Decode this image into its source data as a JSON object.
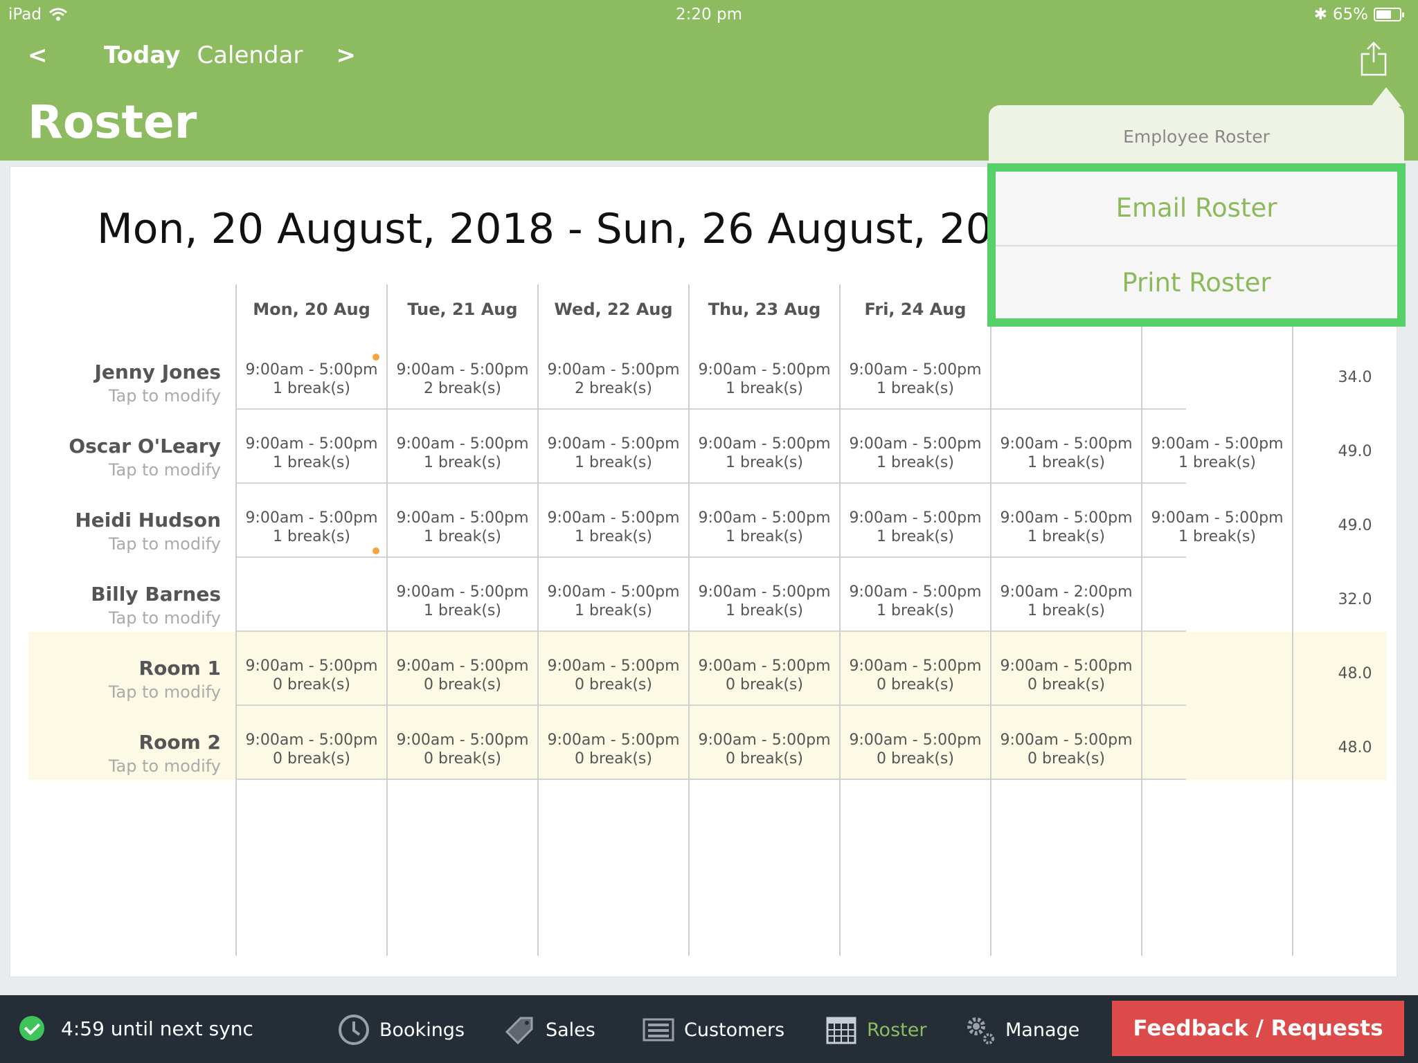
{
  "status_bar": {
    "device": "iPad",
    "time": "2:20 pm",
    "battery_percent": "65%",
    "battery_level": 0.65
  },
  "header": {
    "prev_label": "<",
    "today_label": "Today",
    "calendar_label": "Calendar",
    "next_label": ">",
    "title": "Roster",
    "brand_color": "#8dbb60"
  },
  "content": {
    "date_range": "Mon, 20 August, 2018 - Sun, 26 August, 2018",
    "columns": [
      "Mon, 20 Aug",
      "Tue, 21 Aug",
      "Wed, 22 Aug",
      "Thu, 23 Aug",
      "Fri, 24 Aug"
    ],
    "rows": [
      {
        "name": "Jenny Jones",
        "sub": "Tap to modify",
        "total": "34.0",
        "cells": [
          {
            "time": "9:00am - 5:00pm",
            "breaks": "1 break(s)"
          },
          {
            "time": "9:00am - 5:00pm",
            "breaks": "2 break(s)"
          },
          {
            "time": "9:00am - 5:00pm",
            "breaks": "2 break(s)"
          },
          {
            "time": "9:00am - 5:00pm",
            "breaks": "1 break(s)"
          },
          {
            "time": "9:00am - 5:00pm",
            "breaks": "1 break(s)"
          },
          {
            "time": "",
            "breaks": ""
          },
          {
            "time": "",
            "breaks": ""
          }
        ]
      },
      {
        "name": "Oscar O'Leary",
        "sub": "Tap to modify",
        "total": "49.0",
        "cells": [
          {
            "time": "9:00am - 5:00pm",
            "breaks": "1 break(s)"
          },
          {
            "time": "9:00am - 5:00pm",
            "breaks": "1 break(s)"
          },
          {
            "time": "9:00am - 5:00pm",
            "breaks": "1 break(s)"
          },
          {
            "time": "9:00am - 5:00pm",
            "breaks": "1 break(s)"
          },
          {
            "time": "9:00am - 5:00pm",
            "breaks": "1 break(s)"
          },
          {
            "time": "9:00am - 5:00pm",
            "breaks": "1 break(s)"
          },
          {
            "time": "9:00am - 5:00pm",
            "breaks": "1 break(s)"
          }
        ]
      },
      {
        "name": "Heidi Hudson",
        "sub": "Tap to modify",
        "total": "49.0",
        "cells": [
          {
            "time": "9:00am - 5:00pm",
            "breaks": "1 break(s)"
          },
          {
            "time": "9:00am - 5:00pm",
            "breaks": "1 break(s)"
          },
          {
            "time": "9:00am - 5:00pm",
            "breaks": "1 break(s)"
          },
          {
            "time": "9:00am - 5:00pm",
            "breaks": "1 break(s)"
          },
          {
            "time": "9:00am - 5:00pm",
            "breaks": "1 break(s)"
          },
          {
            "time": "9:00am - 5:00pm",
            "breaks": "1 break(s)"
          },
          {
            "time": "9:00am - 5:00pm",
            "breaks": "1 break(s)"
          }
        ]
      },
      {
        "name": "Billy Barnes",
        "sub": "Tap to modify",
        "total": "32.0",
        "cells": [
          {
            "time": "",
            "breaks": ""
          },
          {
            "time": "9:00am - 5:00pm",
            "breaks": "1 break(s)"
          },
          {
            "time": "9:00am - 5:00pm",
            "breaks": "1 break(s)"
          },
          {
            "time": "9:00am - 5:00pm",
            "breaks": "1 break(s)"
          },
          {
            "time": "9:00am - 5:00pm",
            "breaks": "1 break(s)"
          },
          {
            "time": "9:00am - 2:00pm",
            "breaks": "1 break(s)"
          },
          {
            "time": "",
            "breaks": ""
          }
        ]
      },
      {
        "name": "Room 1",
        "sub": "Tap to modify",
        "total": "48.0",
        "cells": [
          {
            "time": "9:00am - 5:00pm",
            "breaks": "0 break(s)"
          },
          {
            "time": "9:00am - 5:00pm",
            "breaks": "0 break(s)"
          },
          {
            "time": "9:00am - 5:00pm",
            "breaks": "0 break(s)"
          },
          {
            "time": "9:00am - 5:00pm",
            "breaks": "0 break(s)"
          },
          {
            "time": "9:00am - 5:00pm",
            "breaks": "0 break(s)"
          },
          {
            "time": "9:00am - 5:00pm",
            "breaks": "0 break(s)"
          },
          {
            "time": "",
            "breaks": ""
          }
        ]
      },
      {
        "name": "Room 2",
        "sub": "Tap to modify",
        "total": "48.0",
        "cells": [
          {
            "time": "9:00am - 5:00pm",
            "breaks": "0 break(s)"
          },
          {
            "time": "9:00am - 5:00pm",
            "breaks": "0 break(s)"
          },
          {
            "time": "9:00am - 5:00pm",
            "breaks": "0 break(s)"
          },
          {
            "time": "9:00am - 5:00pm",
            "breaks": "0 break(s)"
          },
          {
            "time": "9:00am - 5:00pm",
            "breaks": "0 break(s)"
          },
          {
            "time": "9:00am - 5:00pm",
            "breaks": "0 break(s)"
          },
          {
            "time": "",
            "breaks": ""
          }
        ]
      }
    ],
    "indicator_color": "#f5a440",
    "room_row_color": "#fcfae5"
  },
  "popover": {
    "title": "Employee Roster",
    "items": [
      "Email Roster",
      "Print Roster"
    ],
    "highlight_color": "#56d16a"
  },
  "bottom_bar": {
    "sync_text": "4:59 until next sync",
    "tabs": [
      {
        "label": "Bookings",
        "icon": "clock-icon"
      },
      {
        "label": "Sales",
        "icon": "price-tag-icon"
      },
      {
        "label": "Customers",
        "icon": "register-icon"
      },
      {
        "label": "Roster",
        "icon": "calendar-icon",
        "active": true
      },
      {
        "label": "Manage",
        "icon": "gear-icon"
      }
    ],
    "feedback_label": "Feedback / Requests",
    "feedback_color": "#dd4a4a"
  }
}
